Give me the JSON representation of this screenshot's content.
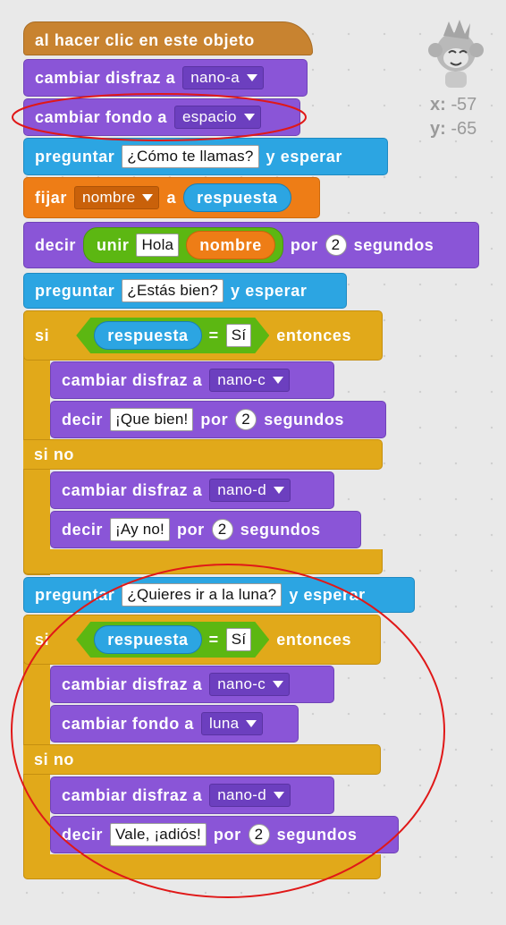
{
  "sprite": {
    "icon": "monkey-sprite-icon",
    "x_label": "x:",
    "x_value": "-57",
    "y_label": "y:",
    "y_value": "-65"
  },
  "blocks": {
    "hat": "al hacer clic en este objeto",
    "costume_label": "cambiar disfraz a",
    "backdrop_label": "cambiar fondo a",
    "ask_label": "preguntar",
    "wait_label": "y esperar",
    "set_label": "fijar",
    "to_label": "a",
    "say_label": "decir",
    "for_label": "por",
    "seconds_label": "segundos",
    "join_label": "unir",
    "if_label": "si",
    "then_label": "entonces",
    "else_label": "si no",
    "answer_label": "respuesta",
    "equals_label": "=",
    "name_var": "nombre",
    "costume1": "nano-a",
    "backdrop1": "espacio",
    "question1": "¿Cómo te llamas?",
    "hola": "Hola",
    "two": "2",
    "question2": "¿Estás bien?",
    "si_value": "Sí",
    "costume_c": "nano-c",
    "good": "¡Que bien!",
    "costume_d": "nano-d",
    "bad": "¡Ay no!",
    "question3": "¿Quieres ir a la luna?",
    "backdrop2": "luna",
    "bye": "Vale, ¡adiós!"
  },
  "colors": {
    "looks": "#8a55d7",
    "sensing": "#2ca5e2",
    "data": "#ee7d16",
    "control": "#e1a91a",
    "events": "#c88330",
    "operators": "#5cb712",
    "highlight": "#e01818"
  }
}
